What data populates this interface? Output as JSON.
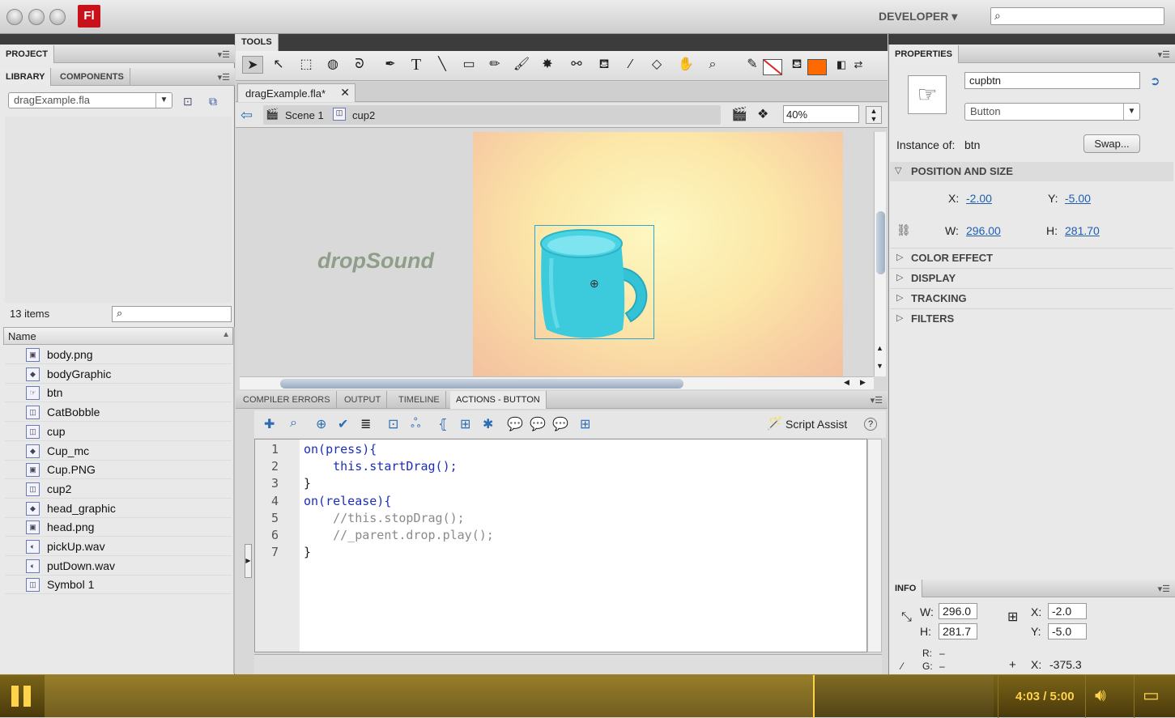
{
  "window": {
    "app_logo": "Fl",
    "workspace_label": "DEVELOPER ▾"
  },
  "left": {
    "project_tab": "PROJECT",
    "library_tab": "LIBRARY",
    "components_tab": "COMPONENTS",
    "file_select": "dragExample.fla",
    "items_count": "13 items",
    "name_header": "Name",
    "items": [
      {
        "name": "body.png",
        "icon": "bitmap-icon"
      },
      {
        "name": "bodyGraphic",
        "icon": "graphic-symbol-icon"
      },
      {
        "name": "btn",
        "icon": "button-symbol-icon"
      },
      {
        "name": "CatBobble",
        "icon": "movieclip-symbol-icon"
      },
      {
        "name": "cup",
        "icon": "movieclip-symbol-icon"
      },
      {
        "name": "Cup_mc",
        "icon": "graphic-symbol-icon"
      },
      {
        "name": "Cup.PNG",
        "icon": "bitmap-icon"
      },
      {
        "name": "cup2",
        "icon": "movieclip-symbol-icon"
      },
      {
        "name": "head_graphic",
        "icon": "graphic-symbol-icon"
      },
      {
        "name": "head.png",
        "icon": "bitmap-icon"
      },
      {
        "name": "pickUp.wav",
        "icon": "sound-icon"
      },
      {
        "name": "putDown.wav",
        "icon": "sound-icon"
      },
      {
        "name": "Symbol 1",
        "icon": "movieclip-symbol-icon"
      }
    ]
  },
  "center": {
    "tools_tab": "TOOLS",
    "doc_tab": "dragExample.fla*",
    "scene_label": "Scene 1",
    "symbol_crumb": "cup2",
    "zoom": "40%",
    "stage_text": "dropSound",
    "panel_tabs": [
      "COMPILER ERRORS",
      "OUTPUT",
      "TIMELINE",
      "ACTIONS - BUTTON"
    ],
    "script_assist": "Script Assist",
    "code_lines": [
      {
        "n": "1",
        "t": "on(press){"
      },
      {
        "n": "2",
        "t": "    this.startDrag();"
      },
      {
        "n": "3",
        "t": "}"
      },
      {
        "n": "4",
        "t": "on(release){"
      },
      {
        "n": "5",
        "t": "    //this.stopDrag();"
      },
      {
        "n": "6",
        "t": "    //_parent.drop.play();"
      },
      {
        "n": "7",
        "t": "}"
      }
    ]
  },
  "properties": {
    "tab": "PROPERTIES",
    "instance_name": "cupbtn",
    "type": "Button",
    "instance_of_label": "Instance of:",
    "instance_of_value": "btn",
    "swap_label": "Swap...",
    "position_size_title": "POSITION AND SIZE",
    "x_label": "X:",
    "x_value": "-2.00",
    "y_label": "Y:",
    "y_value": "-5.00",
    "w_label": "W:",
    "w_value": "296.00",
    "h_label": "H:",
    "h_value": "281.70",
    "sections": [
      "COLOR EFFECT",
      "DISPLAY",
      "TRACKING",
      "FILTERS"
    ]
  },
  "info": {
    "tab": "INFO",
    "w_label": "W:",
    "w_value": "296.0",
    "h_label": "H:",
    "h_value": "281.7",
    "x_label": "X:",
    "x_value": "-2.0",
    "y_label": "Y:",
    "y_value": "-5.0",
    "r_label": "R:",
    "r_value": "–",
    "g_label": "G:",
    "g_value": "–",
    "mx_label": "X:",
    "mx_value": "-375.3"
  },
  "player": {
    "time": "4:03 / 5:00",
    "progress": 0.81,
    "accent": "#ffd34a"
  },
  "colors": {
    "stroke_swatch": "#e02020",
    "fill_swatch": "#ff6a00",
    "selection": "#2aa7d9"
  }
}
